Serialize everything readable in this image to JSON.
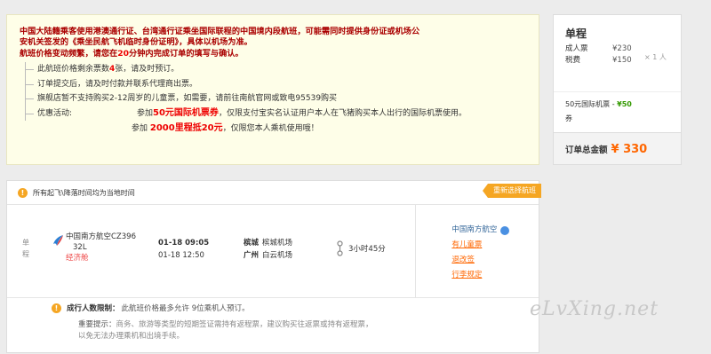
{
  "notice": {
    "intro_line1": "中国大陆籍乘客使用港澳通行证、台湾通行证乘坐国际联程的中国境内段航班，可能需同时提供身份证或机场公",
    "intro_line2": "安机关签发的《乘坐民航飞机临时身份证明》，具体以机场为准。",
    "intro2_a": "航班价格变动频繁，请您在",
    "intro2_num": "20",
    "intro2_b": "分钟内完成订单的填写与确认。",
    "items": [
      {
        "text_a": "此航班价格剩余票数",
        "red": "4",
        "text_b": "张，请及时预订。"
      },
      {
        "text_a": "订单提交后，请及时付款并联系代理商出票。",
        "red": "",
        "text_b": ""
      },
      {
        "text_a": "旗舰店暂不支持购买2-12周岁的儿童票，如需要，请前往南航官网或致电95539购买",
        "red": "",
        "text_b": ""
      }
    ],
    "promo_label": "优惠活动:",
    "promo1_a": "参加",
    "promo1_red": "50元国际机票券",
    "promo1_b": "，仅限支付宝实名认证用户本人在飞猪购买本人出行的国际机票使用。",
    "promo2_a": "参加",
    "promo2_red": "2000里程抵20元",
    "promo2_b": "，仅限您本人乘机使用哦！"
  },
  "summary": {
    "title": "单程",
    "adult_label": "成人票",
    "adult_price": "¥230",
    "tax_label": "税费",
    "tax_price": "¥150",
    "multiplier": "× 1 人",
    "coupon_a": "50元国际机票",
    "coupon_b": "券",
    "coupon_dash": " - ",
    "coupon_value": "¥50",
    "total_label": "订单总金额",
    "total_amount": "¥ 330"
  },
  "flight": {
    "header_note": "所有起飞\\降落时间均为当地时间",
    "reselect": "重新选择航班",
    "trip_type": "单程",
    "airline": "中国南方航空CZ396",
    "cabin": "32L",
    "cabin_class": "经济舱",
    "dep_time": "01-18 09:05",
    "arr_time": "01-18 12:50",
    "dep_city": "槟城",
    "dep_airport": "槟城机场",
    "arr_city": "广州",
    "arr_airport": "白云机场",
    "duration": "3小时45分",
    "side_airline": "中国南方航空",
    "links": [
      "有儿童票",
      "退改签",
      "行李规定"
    ],
    "limit_label": "成行人数限制：",
    "limit_text": "此航班价格最多允许 9位乘机人预订。",
    "tip_label": "重要提示：",
    "tip_text": "商务、旅游等类型的短期签证需持有返程票，建议购买往返票或持有返程票，以免无法办理乘机和出境手续。"
  },
  "watermark": "eLvXing.net"
}
